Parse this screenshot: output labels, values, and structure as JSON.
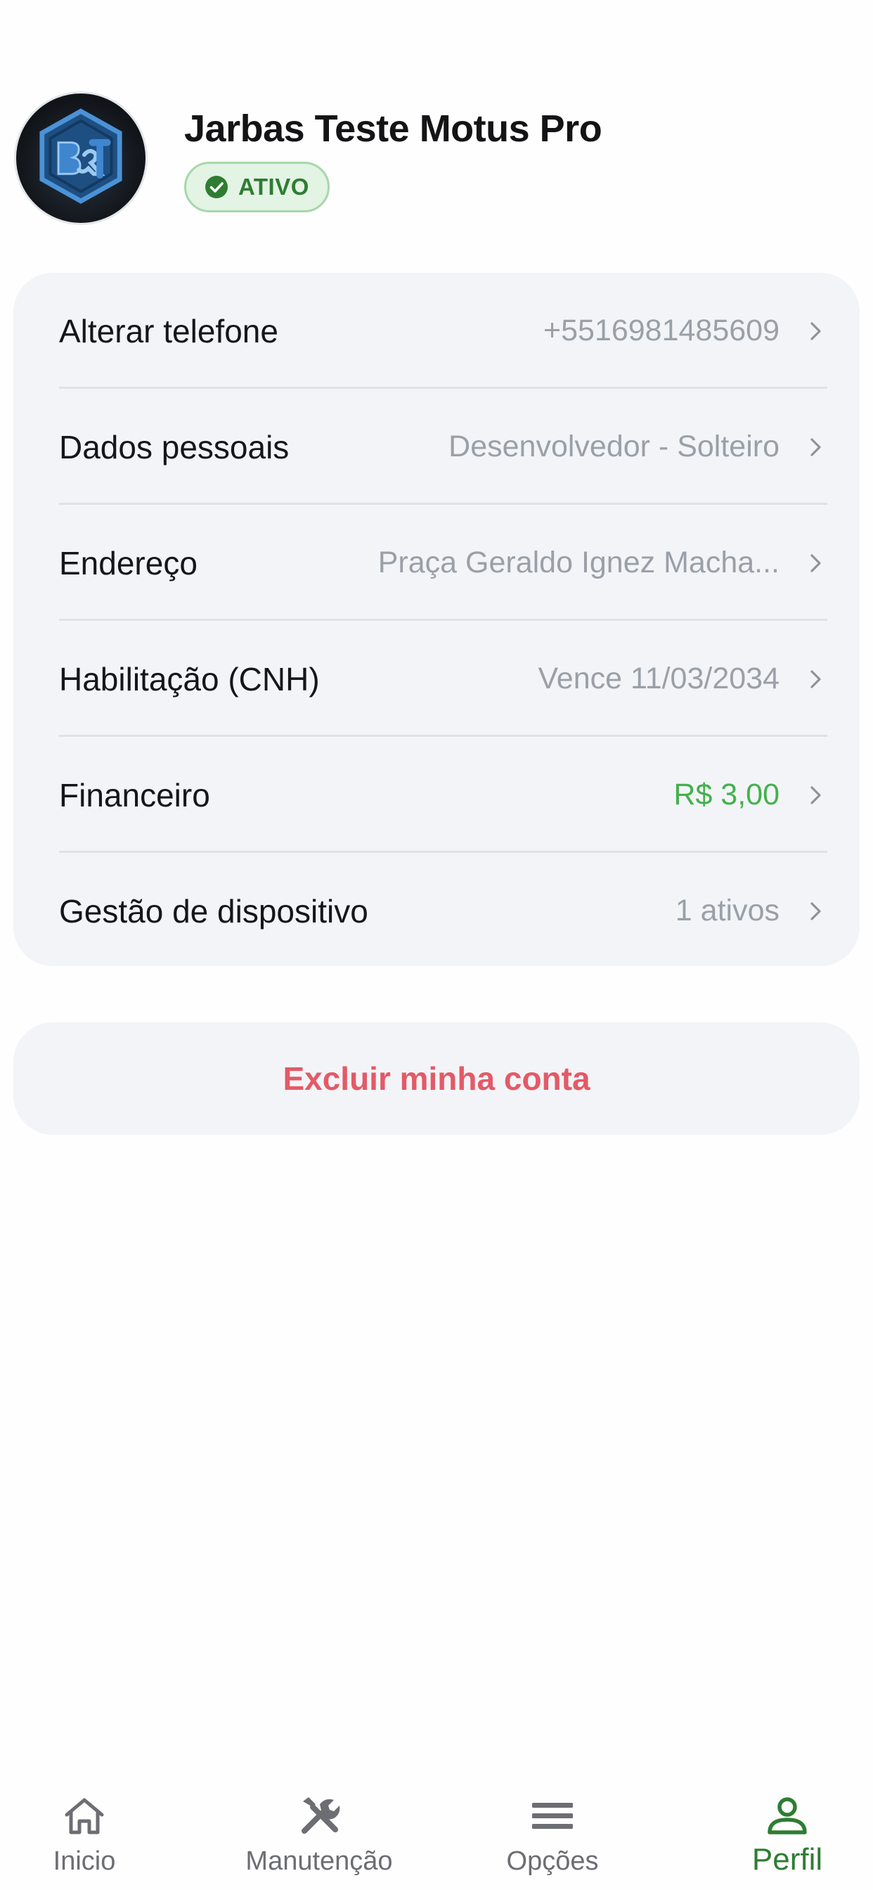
{
  "profile": {
    "name": "Jarbas Teste Motus Pro",
    "status": "ATIVO",
    "avatar_icon": "company-logo-icon"
  },
  "settings": {
    "items": [
      {
        "label": "Alterar telefone",
        "value": "+5516981485609",
        "icon": "chevron-right-icon"
      },
      {
        "label": "Dados pessoais",
        "value": "Desenvolvedor - Solteiro",
        "icon": "chevron-right-icon"
      },
      {
        "label": "Endereço",
        "value": "Praça Geraldo Ignez Macha...",
        "icon": "chevron-right-icon"
      },
      {
        "label": "Habilitação (CNH)",
        "value": "Vence 11/03/2034",
        "icon": "chevron-right-icon"
      },
      {
        "label": "Financeiro",
        "value": "R$ 3,00",
        "icon": "chevron-right-icon"
      },
      {
        "label": "Gestão de dispositivo",
        "value": "1 ativos",
        "icon": "chevron-right-icon"
      }
    ]
  },
  "actions": {
    "delete_account": "Excluir minha conta"
  },
  "nav": {
    "items": [
      {
        "label": "Inicio",
        "icon": "home-icon"
      },
      {
        "label": "Manutenção",
        "icon": "tools-icon"
      },
      {
        "label": "Opções",
        "icon": "menu-icon"
      },
      {
        "label": "Perfil",
        "icon": "user-icon",
        "active": true
      }
    ]
  },
  "colors": {
    "accent": "#2e7d32",
    "positive_value": "#43b14d",
    "danger": "#e35a67",
    "card_bg": "#f3f4f7",
    "muted_text": "#9aa0a8"
  }
}
